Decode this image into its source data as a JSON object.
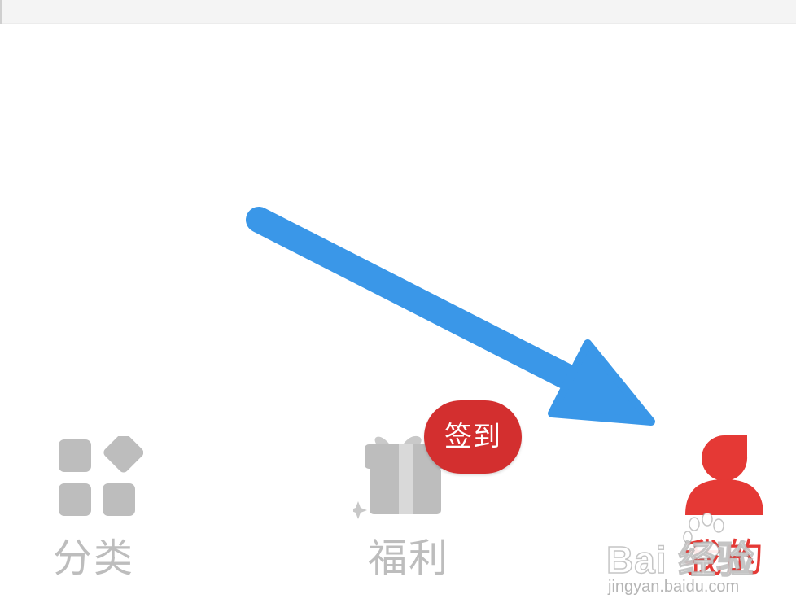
{
  "tabbar": {
    "tabs": [
      {
        "label": "分类",
        "icon": "category-grid-icon",
        "active": false
      },
      {
        "label": "福利",
        "icon": "gift-box-icon",
        "active": false
      },
      {
        "label": "我的",
        "icon": "user-profile-icon",
        "active": true
      }
    ],
    "badge": "签到"
  },
  "annotation": {
    "type": "arrow",
    "color": "#3a97e8"
  },
  "watermark": {
    "brand": "Bai  经验",
    "url": "jingyan.baidu.com"
  },
  "colors": {
    "active": "#e53935",
    "inactive": "#bdbdbd",
    "badge": "#d32f2f"
  }
}
